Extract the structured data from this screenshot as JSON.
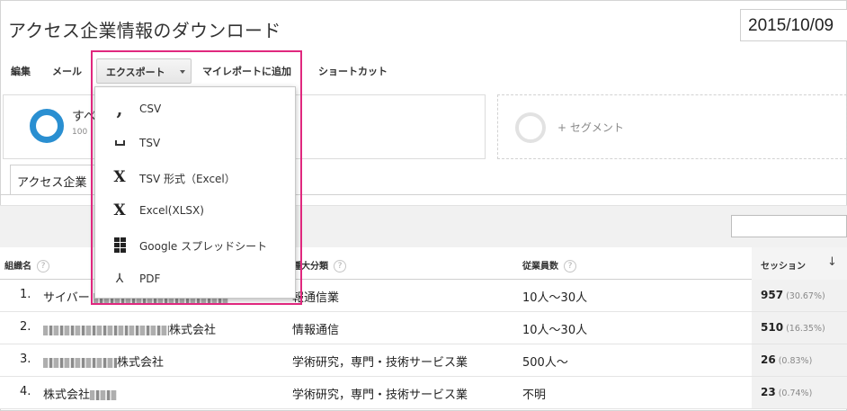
{
  "page": {
    "title": "アクセス企業情報のダウンロード",
    "date": "2015/10/09"
  },
  "toolbar": {
    "edit": "編集",
    "mail": "メール",
    "export": "エクスポート",
    "add_report": "マイレポートに追加",
    "shortcut": "ショートカット"
  },
  "export_menu": {
    "items": [
      {
        "label": "CSV",
        "icon": "comma-icon"
      },
      {
        "label": "TSV",
        "icon": "space-icon"
      },
      {
        "label": "TSV 形式（Excel）",
        "icon": "excel-icon"
      },
      {
        "label": "Excel(XLSX)",
        "icon": "excel-icon"
      },
      {
        "label": "Google スプレッドシート",
        "icon": "sheets-icon"
      },
      {
        "label": "PDF",
        "icon": "pdf-icon"
      }
    ]
  },
  "segment": {
    "name": "すべ",
    "pct": "100",
    "add_label": "+ セグメント"
  },
  "tab": {
    "label": "アクセス企業"
  },
  "table": {
    "headers": {
      "org": "組織名",
      "industry": "種大分類",
      "employees": "従業員数",
      "sessions": "セッション"
    },
    "sort_arrow": "↓",
    "help_mark": "?",
    "rows": [
      {
        "idx": "1.",
        "name": "サイバー",
        "industry": "報通信業",
        "employees": "10人～30人",
        "sessions": "957",
        "pct": "(30.67%)"
      },
      {
        "idx": "2.",
        "name": "株式会社",
        "industry": "情報通信",
        "employees": "10人～30人",
        "sessions": "510",
        "pct": "(16.35%)"
      },
      {
        "idx": "3.",
        "name": "株式会社",
        "industry": "学術研究，専門・技術サービス業",
        "employees": "500人～",
        "sessions": "26",
        "pct": "(0.83%)"
      },
      {
        "idx": "4.",
        "name": "株式会社",
        "industry": "学術研究，専門・技術サービス業",
        "employees": "不明",
        "sessions": "23",
        "pct": "(0.74%)"
      }
    ]
  },
  "colors": {
    "highlight": "#e0287e",
    "segment_ring": "#2a8fd1"
  }
}
